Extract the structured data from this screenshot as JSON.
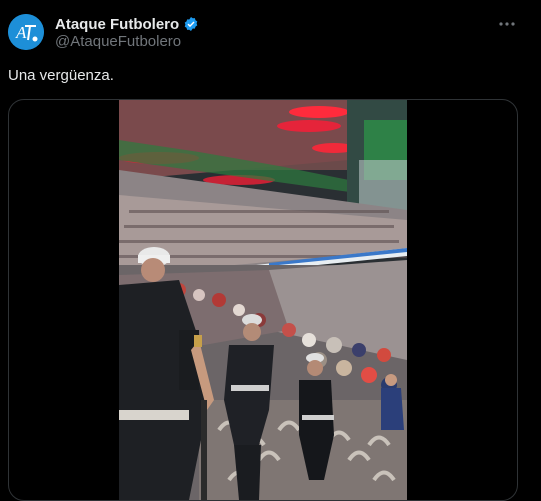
{
  "tweet": {
    "display_name": "Ataque Futbolero",
    "handle": "@AtaqueFutbolero",
    "text": "Una vergüenza.",
    "verified": true,
    "more_icon": "more-horizontal-icon"
  },
  "media": {
    "type": "video",
    "content": "stadium-crowd-scene"
  },
  "colors": {
    "background": "#000000",
    "text_primary": "#e7e9ea",
    "text_secondary": "#71767b",
    "verified": "#1d9bf0",
    "border": "#2f3336"
  }
}
